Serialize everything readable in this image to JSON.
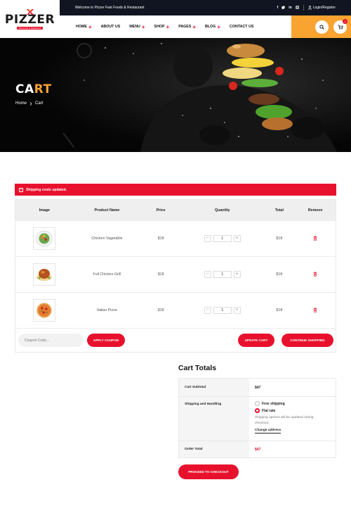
{
  "topbar": {
    "welcome": "Welcome to Pizzer Fast Foods & Restaurant",
    "social": [
      "f",
      "t",
      "in",
      "ig"
    ],
    "login": "Login/Register"
  },
  "logo": {
    "name": "PIZZER",
    "tagline": "Fast Food & Restaurant"
  },
  "nav": [
    {
      "label": "HOME",
      "plus": "+"
    },
    {
      "label": "ABOUT US",
      "plus": ""
    },
    {
      "label": "MENU",
      "plus": "+"
    },
    {
      "label": "SHOP",
      "plus": "+"
    },
    {
      "label": "PAGES",
      "plus": "+"
    },
    {
      "label": "BLOG",
      "plus": "+"
    },
    {
      "label": "CONTACT US",
      "plus": ""
    }
  ],
  "cart_count": "0",
  "hero": {
    "title_main": "CA",
    "title_accent": "RT",
    "breadcrumb_home": "Home",
    "breadcrumb_current": "Cart"
  },
  "notice": "Shipping costs updated.",
  "table": {
    "headers": [
      "Image",
      "Product Name",
      "Price",
      "Quantity",
      "Total",
      "Remove"
    ],
    "rows": [
      {
        "name": "Chicken Vagetable",
        "price": "$18",
        "qty": "1",
        "total": "$18",
        "image": "salad-bowl"
      },
      {
        "name": "Full Chicken Grill",
        "price": "$18",
        "qty": "1",
        "total": "$18",
        "image": "roast-chicken"
      },
      {
        "name": "Italian Pizza",
        "price": "$18",
        "qty": "1",
        "total": "$18",
        "image": "pizza"
      }
    ]
  },
  "coupon": {
    "placeholder": "Coupon Code...",
    "apply": "APPLY COUPON"
  },
  "update_cart": "UPDATE CART",
  "continue": "CONTINUE SHOPPING",
  "totals": {
    "title": "Cart Totals",
    "subtotal_label": "Cart Subtotal",
    "subtotal": "$47",
    "shipping_label": "Shipping and Handling",
    "free_shipping": "Free shipping",
    "flat_rate": "Flat rate",
    "shipping_note": "Shipping options will be updated during checkout.",
    "change_address": "Change address",
    "total_label": "Order Total",
    "total": "$47"
  },
  "checkout": "PROCEED TO CHECKOUT",
  "colors": {
    "accent_red": "#e8112d",
    "accent_orange": "#f9a330",
    "dark": "#111522"
  }
}
